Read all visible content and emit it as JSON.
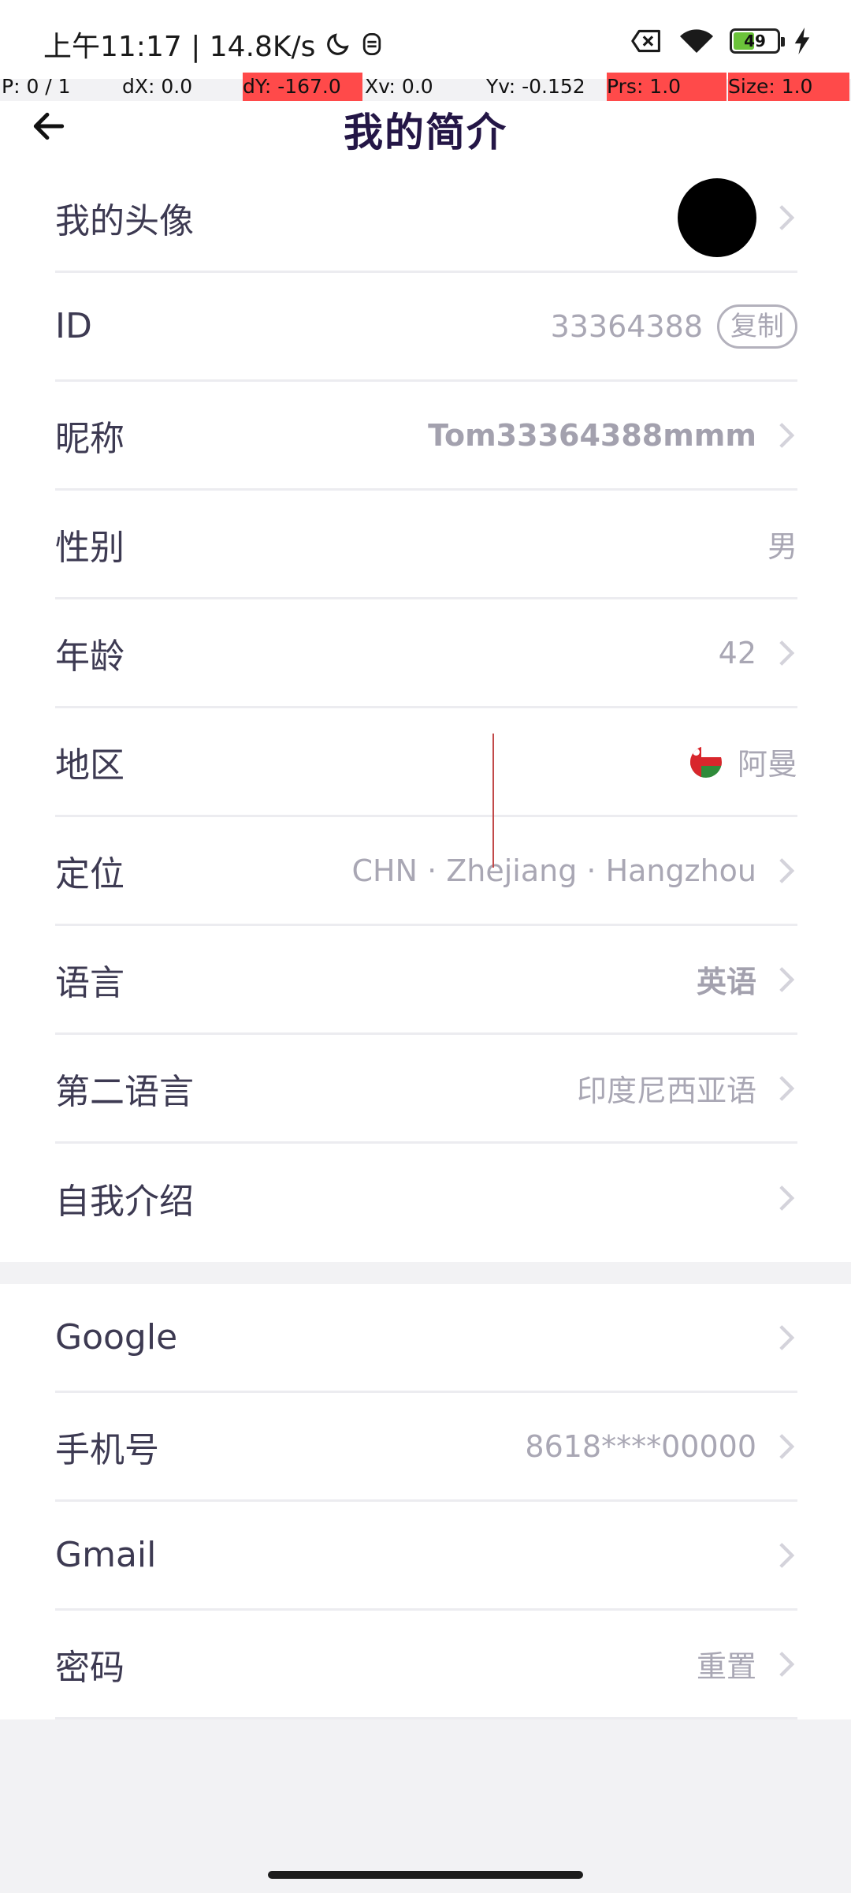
{
  "status_bar": {
    "time": "上午11:17 | 14.8K/s",
    "battery_level": "49",
    "battery_fraction": 0.49
  },
  "debug_overlay": {
    "pointer": "P: 0 / 1",
    "dx": "dX: 0.0",
    "dy": "dY: -167.0",
    "xv": "Xv: 0.0",
    "yv": "Yv: -0.152",
    "prs": "Prs: 1.0",
    "size": "Size: 1.0",
    "highlight_color": "#ff4a4a"
  },
  "header": {
    "title": "我的简介",
    "back_icon": "arrow-left-icon"
  },
  "profile": {
    "avatar_label": "我的头像",
    "id_label": "ID",
    "id_value": "33364388",
    "copy_label": "复制",
    "nickname_label": "昵称",
    "nickname_value": "Tom33364388mmm",
    "gender_label": "性别",
    "gender_value": "男",
    "age_label": "年龄",
    "age_value": "42",
    "region_label": "地区",
    "region_value": "阿曼",
    "location_label": "定位",
    "location_value": "CHN · Zhejiang · Hangzhou",
    "language_label": "语言",
    "language_value": "英语",
    "second_language_label": "第二语言",
    "second_language_value": "印度尼西亚语",
    "bio_label": "自我介绍"
  },
  "accounts": {
    "google_label": "Google",
    "phone_label": "手机号",
    "phone_value": "8618****00000",
    "gmail_label": "Gmail",
    "password_label": "密码",
    "password_value": "重置"
  },
  "colors": {
    "title": "#241646",
    "label": "#3d3a52",
    "value": "#a9a7b4",
    "divider": "#ececf0",
    "page_bg": "#f2f2f4"
  }
}
